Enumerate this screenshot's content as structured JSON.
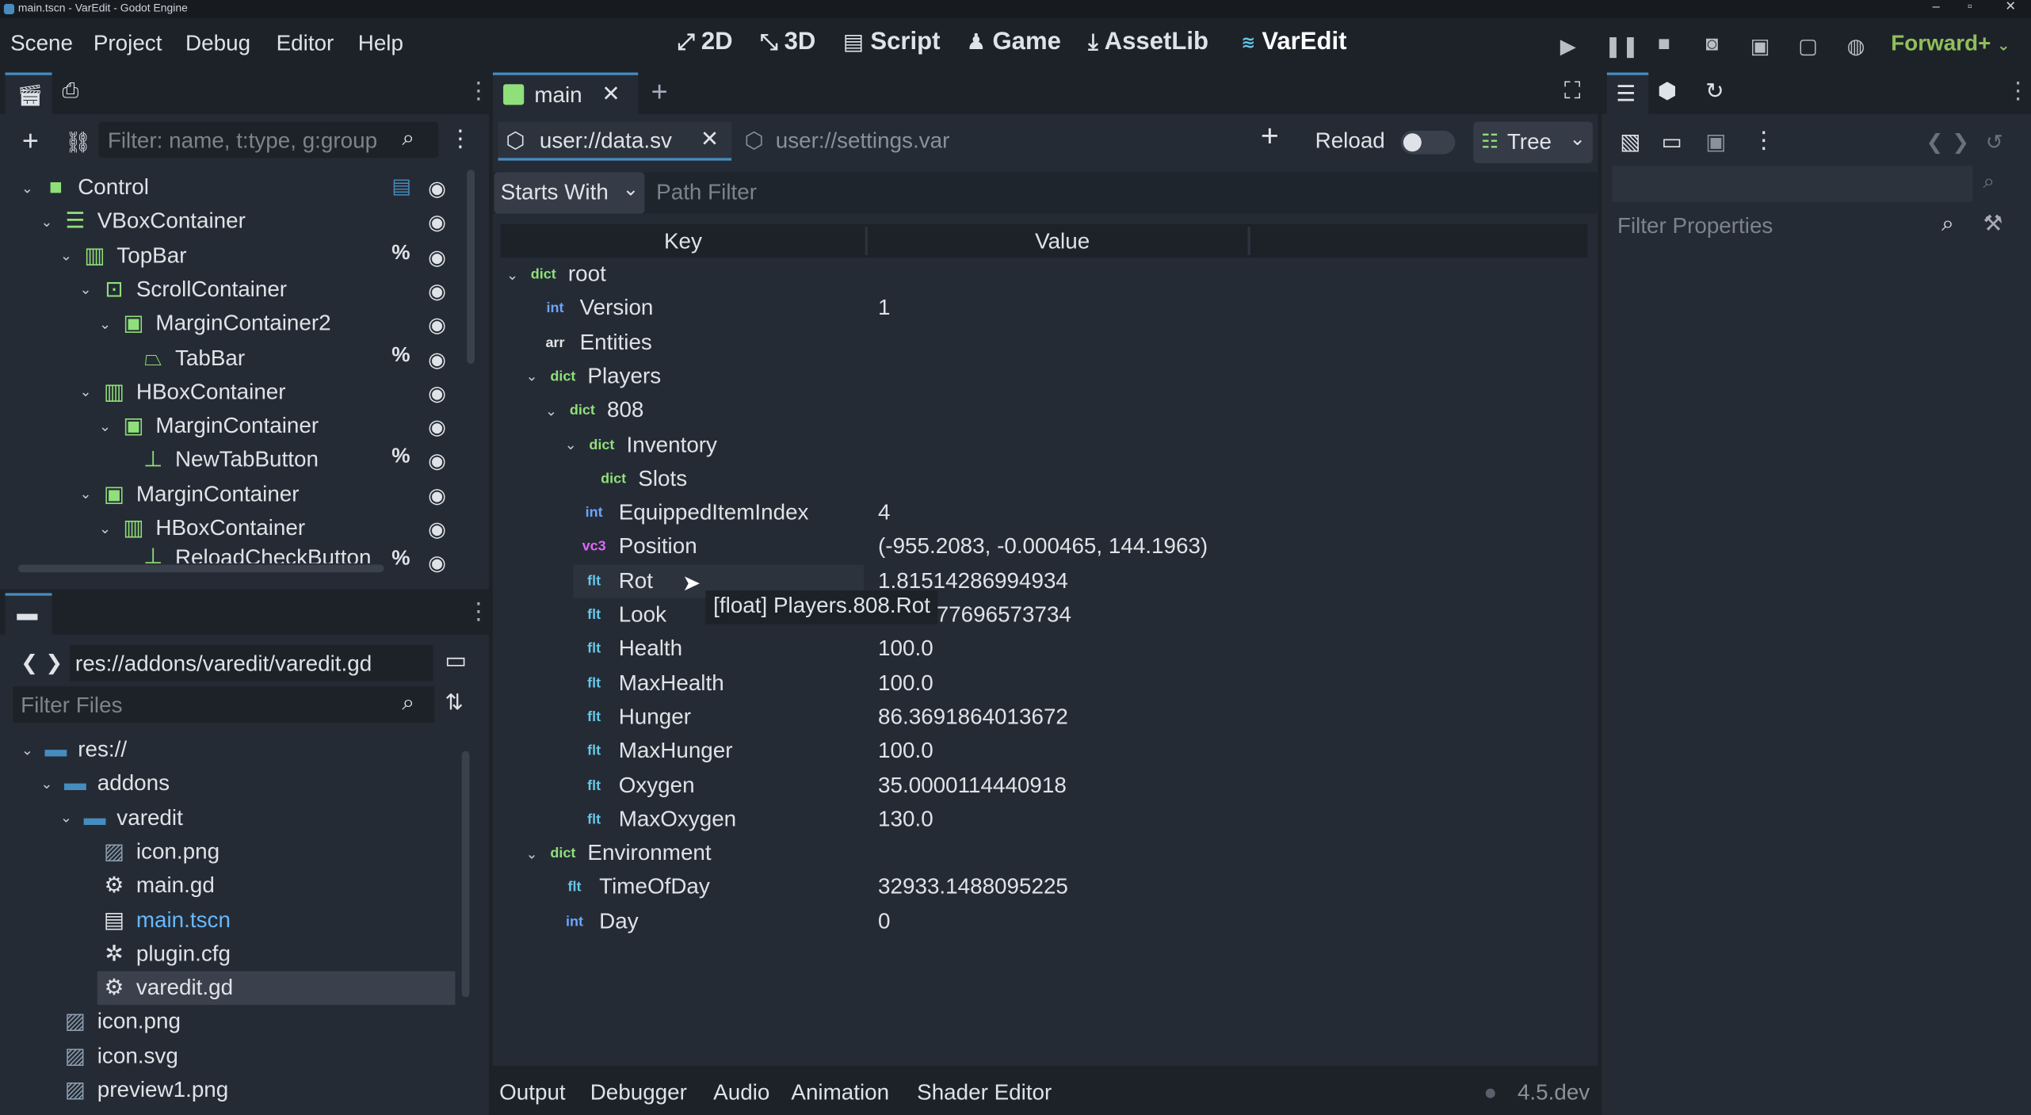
{
  "window": {
    "title": "main.tscn - VarEdit - Godot Engine"
  },
  "menus": [
    "Scene",
    "Project",
    "Debug",
    "Editor",
    "Help"
  ],
  "workspaces": [
    {
      "label": "2D",
      "icon": "2d-icon"
    },
    {
      "label": "3D",
      "icon": "3d-icon"
    },
    {
      "label": "Script",
      "icon": "script-icon"
    },
    {
      "label": "Game",
      "icon": "game-icon"
    },
    {
      "label": "AssetLib",
      "icon": "assetlib-icon"
    },
    {
      "label": "VarEdit",
      "icon": "varedit-icon"
    }
  ],
  "renderer": "Forward+",
  "scene_dock": {
    "filter_placeholder": "Filter: name, t:type, g:group",
    "nodes": [
      {
        "label": "Control",
        "indent": 0,
        "expanded": true,
        "icon": "control-icon",
        "pct": false,
        "script": true
      },
      {
        "label": "VBoxContainer",
        "indent": 1,
        "expanded": true,
        "icon": "vbox-icon",
        "pct": false
      },
      {
        "label": "TopBar",
        "indent": 2,
        "expanded": true,
        "icon": "hbox-icon",
        "pct": true
      },
      {
        "label": "ScrollContainer",
        "indent": 3,
        "expanded": true,
        "icon": "scroll-icon",
        "pct": false
      },
      {
        "label": "MarginContainer2",
        "indent": 4,
        "expanded": true,
        "icon": "margin-icon",
        "pct": false
      },
      {
        "label": "TabBar",
        "indent": 5,
        "expanded": false,
        "icon": "tabbar-icon",
        "pct": true
      },
      {
        "label": "HBoxContainer",
        "indent": 3,
        "expanded": true,
        "icon": "hbox-icon",
        "pct": false
      },
      {
        "label": "MarginContainer",
        "indent": 4,
        "expanded": true,
        "icon": "margin-icon",
        "pct": false
      },
      {
        "label": "NewTabButton",
        "indent": 5,
        "expanded": false,
        "icon": "button-icon",
        "pct": true
      },
      {
        "label": "MarginContainer",
        "indent": 3,
        "expanded": true,
        "icon": "margin-icon",
        "pct": false
      },
      {
        "label": "HBoxContainer",
        "indent": 4,
        "expanded": true,
        "icon": "hbox-icon",
        "pct": false
      },
      {
        "label": "ReloadCheckButton",
        "indent": 5,
        "expanded": false,
        "icon": "button-icon",
        "pct": true
      }
    ]
  },
  "filesystem": {
    "path": "res://addons/varedit/varedit.gd",
    "filter_placeholder": "Filter Files",
    "items": [
      {
        "label": "res://",
        "indent": 0,
        "type": "folder",
        "expanded": true
      },
      {
        "label": "addons",
        "indent": 1,
        "type": "folder",
        "expanded": true
      },
      {
        "label": "varedit",
        "indent": 2,
        "type": "folder",
        "expanded": true
      },
      {
        "label": "icon.png",
        "indent": 3,
        "type": "image"
      },
      {
        "label": "main.gd",
        "indent": 3,
        "type": "gear"
      },
      {
        "label": "main.tscn",
        "indent": 3,
        "type": "scene",
        "highlight": true
      },
      {
        "label": "plugin.cfg",
        "indent": 3,
        "type": "cfg"
      },
      {
        "label": "varedit.gd",
        "indent": 3,
        "type": "gear",
        "selected": true
      },
      {
        "label": "icon.png",
        "indent": 1,
        "type": "image"
      },
      {
        "label": "icon.svg",
        "indent": 1,
        "type": "image"
      },
      {
        "label": "preview1.png",
        "indent": 1,
        "type": "image"
      }
    ]
  },
  "editor_tab": {
    "label": "main"
  },
  "file_tabs": [
    {
      "label": "user://data.sv",
      "active": true
    },
    {
      "label": "user://settings.var",
      "active": false
    }
  ],
  "toolbar": {
    "reload_label": "Reload",
    "view_mode": "Tree",
    "filter_mode": "Starts With",
    "path_filter_placeholder": "Path Filter"
  },
  "columns": {
    "key": "Key",
    "value": "Value"
  },
  "tree": [
    {
      "key": "root",
      "type": "dict",
      "indent": 0,
      "arrow": true,
      "value": ""
    },
    {
      "key": "Version",
      "type": "int",
      "indent": 1,
      "arrow": false,
      "value": "1"
    },
    {
      "key": "Entities",
      "type": "arr",
      "indent": 1,
      "arrow": false,
      "value": ""
    },
    {
      "key": "Players",
      "type": "dict",
      "indent": 1,
      "arrow": true,
      "value": ""
    },
    {
      "key": "808",
      "type": "dict",
      "indent": 2,
      "arrow": true,
      "value": ""
    },
    {
      "key": "Inventory",
      "type": "dict",
      "indent": 3,
      "arrow": true,
      "value": ""
    },
    {
      "key": "Slots",
      "type": "dict",
      "indent": 4,
      "arrow": false,
      "value": ""
    },
    {
      "key": "EquippedItemIndex",
      "type": "int",
      "indent": 3,
      "arrow": false,
      "value": "4"
    },
    {
      "key": "Position",
      "type": "v3",
      "indent": 3,
      "arrow": false,
      "value": "(-955.2083, -0.000465, 144.1963)"
    },
    {
      "key": "Rot",
      "type": "flt",
      "indent": 3,
      "arrow": false,
      "value": "1.81514286994934",
      "hover": true
    },
    {
      "key": "Look",
      "type": "flt",
      "indent": 3,
      "arrow": false,
      "value": "77696573734"
    },
    {
      "key": "Health",
      "type": "flt",
      "indent": 3,
      "arrow": false,
      "value": "100.0"
    },
    {
      "key": "MaxHealth",
      "type": "flt",
      "indent": 3,
      "arrow": false,
      "value": "100.0"
    },
    {
      "key": "Hunger",
      "type": "flt",
      "indent": 3,
      "arrow": false,
      "value": "86.3691864013672"
    },
    {
      "key": "MaxHunger",
      "type": "flt",
      "indent": 3,
      "arrow": false,
      "value": "100.0"
    },
    {
      "key": "Oxygen",
      "type": "flt",
      "indent": 3,
      "arrow": false,
      "value": "35.0000114440918"
    },
    {
      "key": "MaxOxygen",
      "type": "flt",
      "indent": 3,
      "arrow": false,
      "value": "130.0"
    },
    {
      "key": "Environment",
      "type": "dict",
      "indent": 1,
      "arrow": true,
      "value": ""
    },
    {
      "key": "TimeOfDay",
      "type": "flt",
      "indent": 2,
      "arrow": false,
      "value": "32933.1488095225"
    },
    {
      "key": "Day",
      "type": "int",
      "indent": 2,
      "arrow": false,
      "value": "0"
    }
  ],
  "type_labels": {
    "dict": "dict",
    "int": "int",
    "arr": "arr",
    "flt": "flt",
    "v3": "vc3"
  },
  "tooltip": "[float] Players.808.Rot",
  "bottom_tabs": [
    "Output",
    "Debugger",
    "Audio",
    "Animation",
    "Shader Editor"
  ],
  "version": "4.5.dev",
  "inspector": {
    "filter_placeholder": "Filter Properties"
  },
  "colors": {
    "accent": "#478cbf",
    "background": "#1d2229",
    "panel": "#252b34",
    "renderer": "#8fbf5a",
    "dict": "#8fe07a",
    "float": "#67c7e8"
  }
}
